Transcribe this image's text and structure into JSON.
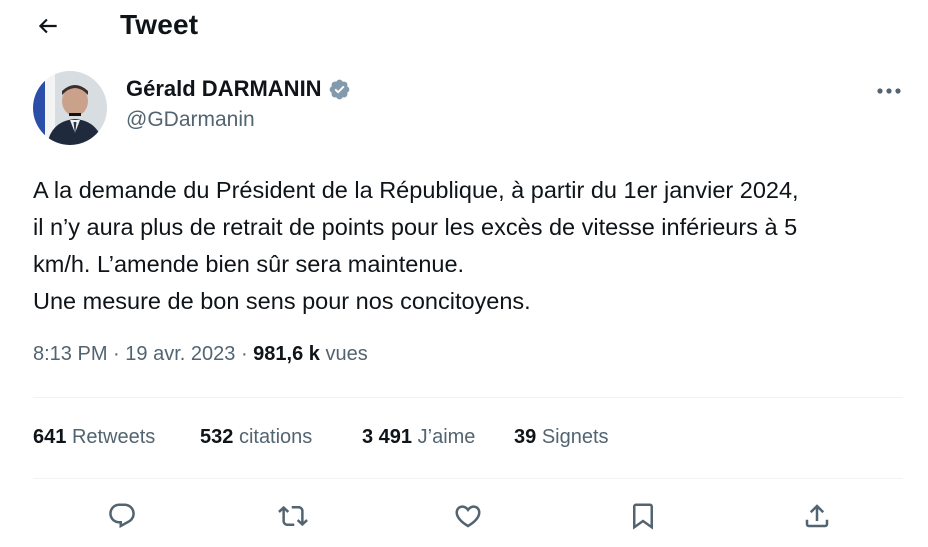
{
  "header": {
    "back_icon": "arrow-left-icon",
    "title": "Tweet"
  },
  "author": {
    "display_name": "Gérald DARMANIN",
    "handle": "@GDarmanin",
    "verified_icon": "verified-badge-icon",
    "verified_color": "#829aab"
  },
  "more_icon": "more-horizontal-icon",
  "tweet": {
    "lines": [
      "A la demande du Président de la République, à partir du 1er janvier 2024,",
      "il n’y aura plus de retrait de points pour les excès de vitesse inférieurs à 5",
      "km/h. L’amende bien sûr sera maintenue.",
      "Une mesure de bon sens pour nos concitoyens."
    ]
  },
  "meta": {
    "time": "8:13 PM",
    "separator": "·",
    "date": "19 avr. 2023",
    "views_count": "981,6 k",
    "views_label": "vues"
  },
  "stats": {
    "retweets": {
      "count": "641",
      "label": "Retweets"
    },
    "quotes": {
      "count": "532",
      "label": "citations"
    },
    "likes": {
      "count": "3 491",
      "label": "J’aime"
    },
    "bookmarks": {
      "count": "39",
      "label": "Signets"
    }
  },
  "actions": [
    "reply-icon",
    "retweet-icon",
    "like-icon",
    "bookmark-icon",
    "share-icon"
  ],
  "colors": {
    "text": "#0f1419",
    "secondary": "#536471",
    "divider": "#eff3f4"
  }
}
